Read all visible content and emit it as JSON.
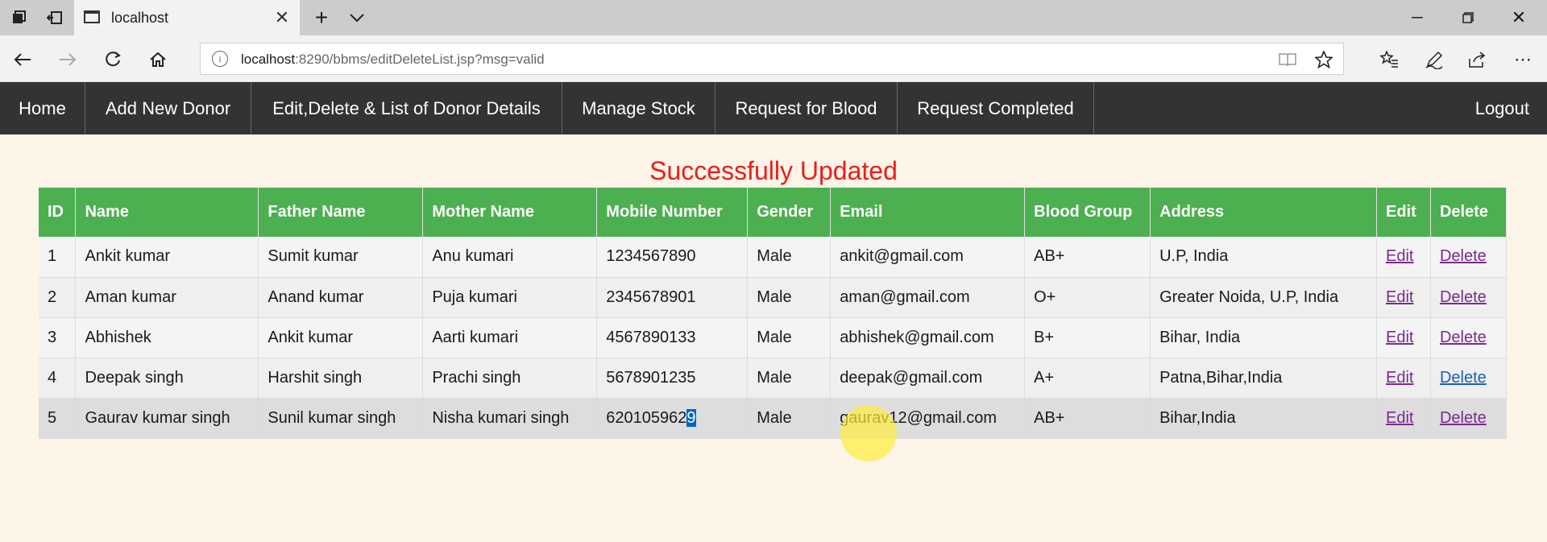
{
  "browser": {
    "tab_title": "localhost",
    "url_host": "localhost",
    "url_path": ":8290/bbms/editDeleteList.jsp?msg=valid"
  },
  "nav": {
    "home": "Home",
    "add_donor": "Add New Donor",
    "edit_delete": "Edit,Delete & List of Donor Details",
    "manage_stock": "Manage Stock",
    "request_blood": "Request for Blood",
    "request_completed": "Request Completed",
    "logout": "Logout"
  },
  "message": "Successfully Updated",
  "table": {
    "headers": [
      "ID",
      "Name",
      "Father Name",
      "Mother Name",
      "Mobile Number",
      "Gender",
      "Email",
      "Blood Group",
      "Address",
      "Edit",
      "Delete"
    ],
    "rows": [
      {
        "id": "1",
        "name": "Ankit kumar",
        "father": "Sumit kumar",
        "mother": "Anu kumari",
        "mobile": "1234567890",
        "gender": "Male",
        "email": "ankit@gmail.com",
        "blood": "AB+",
        "address": "U.P, India",
        "edit": "Edit",
        "delete": "Delete"
      },
      {
        "id": "2",
        "name": "Aman kumar",
        "father": "Anand kumar",
        "mother": "Puja kumari",
        "mobile": "2345678901",
        "gender": "Male",
        "email": "aman@gmail.com",
        "blood": "O+",
        "address": "Greater Noida, U.P, India",
        "edit": "Edit",
        "delete": "Delete"
      },
      {
        "id": "3",
        "name": "Abhishek",
        "father": "Ankit kumar",
        "mother": "Aarti kumari",
        "mobile": "4567890133",
        "gender": "Male",
        "email": "abhishek@gmail.com",
        "blood": "B+",
        "address": "Bihar, India",
        "edit": "Edit",
        "delete": "Delete"
      },
      {
        "id": "4",
        "name": "Deepak singh",
        "father": "Harshit singh",
        "mother": "Prachi singh",
        "mobile": "5678901235",
        "gender": "Male",
        "email": "deepak@gmail.com",
        "blood": "A+",
        "address": "Patna,Bihar,India",
        "edit": "Edit",
        "delete": "Delete"
      },
      {
        "id": "5",
        "name": "Gaurav kumar singh",
        "father": "Sunil kumar singh",
        "mother": "Nisha kumari singh",
        "mobile_main": "620105962",
        "mobile_selected": "9",
        "gender": "Male",
        "email": "gaurav12@gmail.com",
        "blood": "AB+",
        "address": "Bihar,India",
        "edit": "Edit",
        "delete": "Delete"
      }
    ]
  },
  "colors": {
    "nav_bg": "#333333",
    "header_bg": "#4caf50",
    "message": "#ee1c1c",
    "page_bg": "#fdf5e8"
  }
}
